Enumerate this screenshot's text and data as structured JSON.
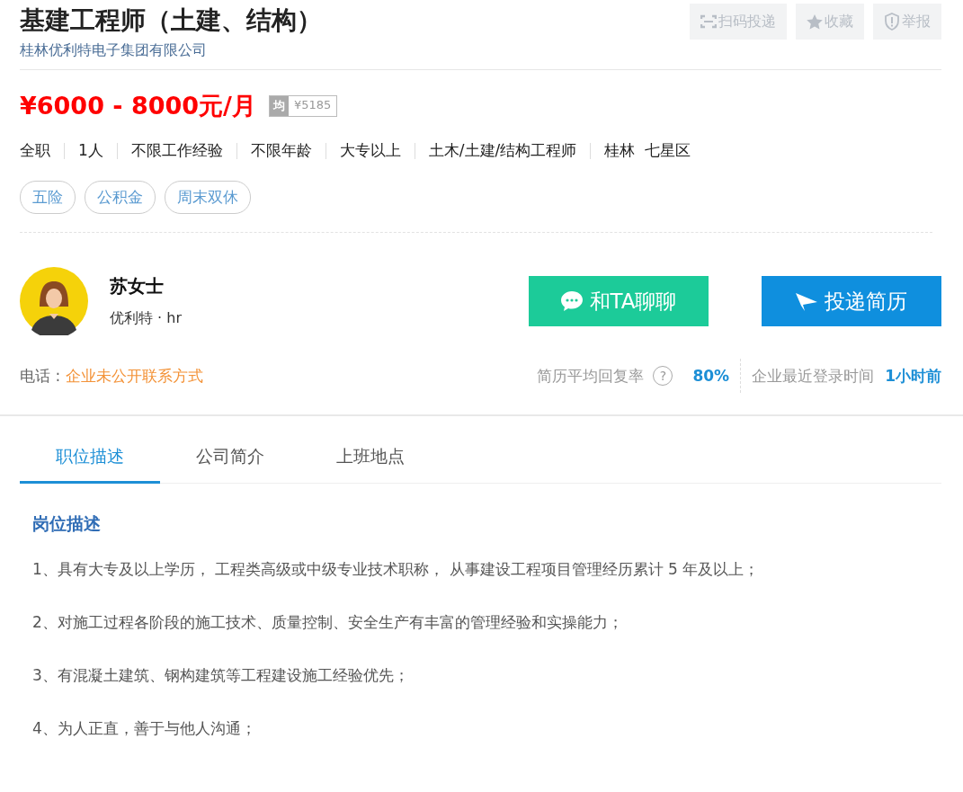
{
  "job": {
    "title": "基建工程师（土建、结构）",
    "company": "桂林优利特电子集团有限公司",
    "actions": [
      {
        "kind": "scan",
        "label": "扫码投递"
      },
      {
        "kind": "star",
        "label": "收藏"
      },
      {
        "kind": "shield",
        "label": "举报"
      }
    ],
    "salary": "¥6000 - 8000元/月",
    "avg_badge": "均",
    "avg_salary": "¥5185",
    "attributes": [
      "全职",
      "1人",
      "不限工作经验",
      "不限年龄",
      "大专以上",
      "土木/土建/结构工程师",
      "桂林  七星区"
    ],
    "benefits": [
      "五险",
      "公积金",
      "周末双休"
    ]
  },
  "recruiter": {
    "name": "苏女士",
    "role": "优利特 · hr",
    "chat_button": "和TA聊聊",
    "apply_button": "投递简历",
    "phone_label": "电话 :",
    "phone_value": "企业未公开联系方式",
    "reply_rate_label": "简历平均回复率",
    "help": "?",
    "reply_rate": "80%",
    "login_label": "企业最近登录时间",
    "login_value": "1小时前"
  },
  "tabs": [
    {
      "label": "职位描述",
      "selected": true
    },
    {
      "label": "公司简介",
      "selected": false
    },
    {
      "label": "上班地点",
      "selected": false
    }
  ],
  "description": {
    "heading": "岗位描述",
    "items": [
      "1、具有大专及以上学历， 工程类高级或中级专业技术职称， 从事建设工程项目管理经历累计 5 年及以上；",
      "2、对施工过程各阶段的施工技术、质量控制、安全生产有丰富的管理经验和实操能力；",
      "3、有混凝土建筑、钢构建筑等工程建设施工经验优先；",
      "4、为人正直，善于与他人沟通；"
    ]
  }
}
